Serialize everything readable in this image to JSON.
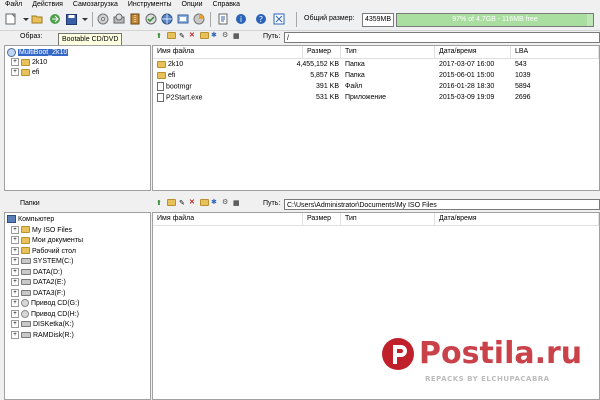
{
  "menu": [
    "Файл",
    "Действия",
    "Самозагрузка",
    "Инструменты",
    "Опции",
    "Справка"
  ],
  "toolbar": {
    "size_label": "Общий размер:",
    "size_value": "4359MB",
    "progress_text": "97% of 4.7GB - 116MB free",
    "progress_fraction": 0.97
  },
  "image_pane": {
    "label": "Образ:",
    "tooltip": "Bootable CD/DVD",
    "path_label": "Путь:",
    "path_value": "/",
    "tree": [
      {
        "label": "MultiBoot_2k10",
        "selected": true
      },
      {
        "label": "2k10"
      },
      {
        "label": "efi"
      }
    ],
    "columns": [
      "Имя файла",
      "Размер",
      "Тип",
      "Дата/время",
      "LBA"
    ],
    "files": [
      {
        "name": "2k10",
        "size": "4,455,152 KB",
        "type": "Папка",
        "date": "2017-03-07 16:00",
        "lba": "543",
        "icon": "folder-icon"
      },
      {
        "name": "efi",
        "size": "5,857 KB",
        "type": "Папка",
        "date": "2015-06-01 15:00",
        "lba": "1039",
        "icon": "folder-icon"
      },
      {
        "name": "bootmgr",
        "size": "391 KB",
        "type": "Файл",
        "date": "2016-01-28 18:30",
        "lba": "5894",
        "icon": "file-icon"
      },
      {
        "name": "P2Start.exe",
        "size": "531 KB",
        "type": "Приложение",
        "date": "2015-03-09 19:09",
        "lba": "2696",
        "icon": "exe-icon"
      }
    ]
  },
  "local_pane": {
    "label": "Папки",
    "path_label": "Путь:",
    "path_value": "C:\\Users\\Administrator\\Documents\\My ISO Files",
    "tree": [
      {
        "label": "Компьютер",
        "icon": "computer-icon",
        "level": 0
      },
      {
        "label": "My ISO Files",
        "icon": "folder-icon",
        "level": 1
      },
      {
        "label": "Мои документы",
        "icon": "folder-icon",
        "level": 1
      },
      {
        "label": "Рабочий стол",
        "icon": "folder-icon",
        "level": 1
      },
      {
        "label": "SYSTEM(C:)",
        "icon": "drive-icon",
        "level": 1
      },
      {
        "label": "DATA(D:)",
        "icon": "drive-icon",
        "level": 1
      },
      {
        "label": "DATA2(E:)",
        "icon": "drive-icon",
        "level": 1
      },
      {
        "label": "DATA3(F:)",
        "icon": "drive-icon",
        "level": 1
      },
      {
        "label": "Привод CD(G:)",
        "icon": "cd-icon",
        "level": 1
      },
      {
        "label": "Привод CD(H:)",
        "icon": "cd-icon",
        "level": 1
      },
      {
        "label": "DISKetka(K:)",
        "icon": "drive-icon",
        "level": 1
      },
      {
        "label": "RAMDisk(R:)",
        "icon": "drive-icon",
        "level": 1
      }
    ],
    "columns": [
      "Имя файла",
      "Размер",
      "Тип",
      "Дата/время"
    ]
  },
  "watermark": {
    "brand": "Postila.ru",
    "subtext": "REPACKS BY ELCHUPACABRA"
  }
}
